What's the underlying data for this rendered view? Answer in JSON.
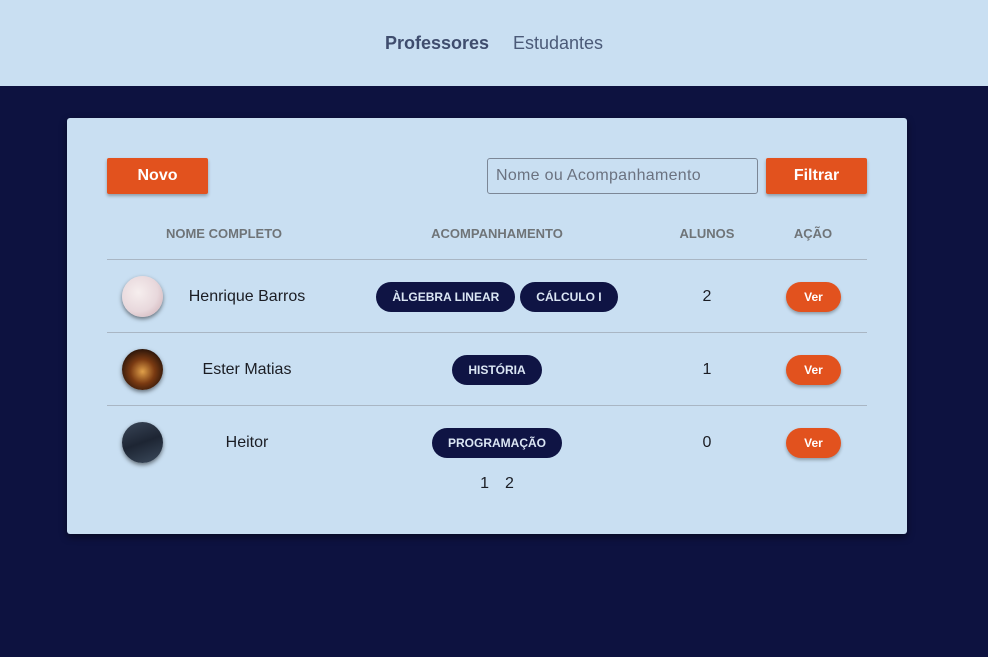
{
  "nav": {
    "professores": "Professores",
    "estudantes": "Estudantes"
  },
  "toolbar": {
    "novo_label": "Novo",
    "search_placeholder": "Nome ou Acompanhamento",
    "search_value": "",
    "filtrar_label": "Filtrar"
  },
  "table": {
    "headers": [
      "Nome Completo",
      "Acompanhamento",
      "Alunos",
      "Ação"
    ],
    "rows": [
      {
        "name": "Henrique Barros",
        "tags": [
          "Àlgebra Linear",
          "Cálculo I"
        ],
        "alunos": "2",
        "action": "Ver"
      },
      {
        "name": "Ester Matias",
        "tags": [
          "História"
        ],
        "alunos": "1",
        "action": "Ver"
      },
      {
        "name": "Heitor",
        "tags": [
          "Programação"
        ],
        "alunos": "0",
        "action": "Ver"
      }
    ]
  },
  "pagination": {
    "pages": [
      "1",
      "2"
    ]
  },
  "colors": {
    "page_bg": "#0d1240",
    "panel_bg": "#c9dff2",
    "accent": "#e2521e",
    "tag_bg": "#0f1444"
  }
}
